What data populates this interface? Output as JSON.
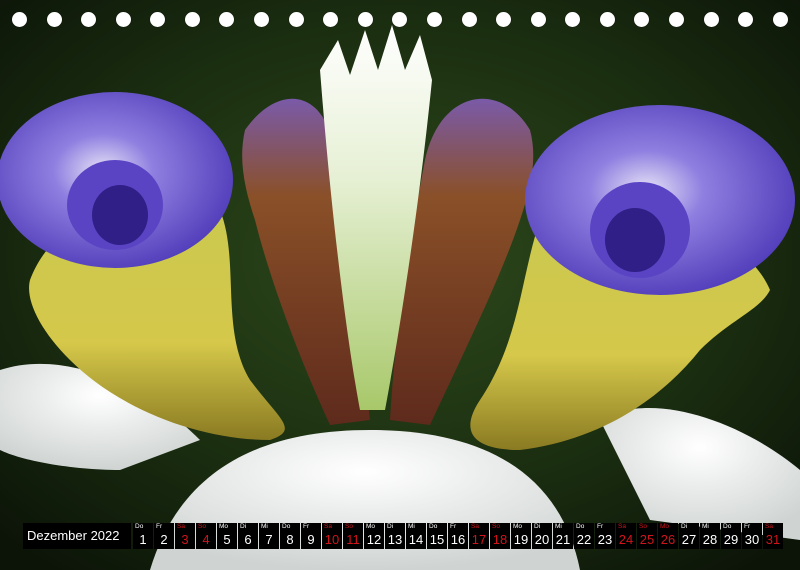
{
  "calendar": {
    "month_label": "Dezember 2022",
    "weekend_color": "#d0141b",
    "days": [
      {
        "wd": "Do",
        "num": "1",
        "weekend": false
      },
      {
        "wd": "Fr",
        "num": "2",
        "weekend": false
      },
      {
        "wd": "Sa",
        "num": "3",
        "weekend": true
      },
      {
        "wd": "So",
        "num": "4",
        "weekend": true
      },
      {
        "wd": "Mo",
        "num": "5",
        "weekend": false
      },
      {
        "wd": "Di",
        "num": "6",
        "weekend": false
      },
      {
        "wd": "Mi",
        "num": "7",
        "weekend": false
      },
      {
        "wd": "Do",
        "num": "8",
        "weekend": false
      },
      {
        "wd": "Fr",
        "num": "9",
        "weekend": false
      },
      {
        "wd": "Sa",
        "num": "10",
        "weekend": true
      },
      {
        "wd": "So",
        "num": "11",
        "weekend": true
      },
      {
        "wd": "Mo",
        "num": "12",
        "weekend": false
      },
      {
        "wd": "Di",
        "num": "13",
        "weekend": false
      },
      {
        "wd": "Mi",
        "num": "14",
        "weekend": false
      },
      {
        "wd": "Do",
        "num": "15",
        "weekend": false
      },
      {
        "wd": "Fr",
        "num": "16",
        "weekend": false
      },
      {
        "wd": "Sa",
        "num": "17",
        "weekend": true
      },
      {
        "wd": "So",
        "num": "18",
        "weekend": true
      },
      {
        "wd": "Mo",
        "num": "19",
        "weekend": false
      },
      {
        "wd": "Di",
        "num": "20",
        "weekend": false
      },
      {
        "wd": "Mi",
        "num": "21",
        "weekend": false
      },
      {
        "wd": "Do",
        "num": "22",
        "weekend": false
      },
      {
        "wd": "Fr",
        "num": "23",
        "weekend": false
      },
      {
        "wd": "Sa",
        "num": "24",
        "weekend": true
      },
      {
        "wd": "So",
        "num": "25",
        "weekend": true
      },
      {
        "wd": "Mo",
        "num": "26",
        "weekend": true
      },
      {
        "wd": "Di",
        "num": "27",
        "weekend": false
      },
      {
        "wd": "Mi",
        "num": "28",
        "weekend": false
      },
      {
        "wd": "Do",
        "num": "29",
        "weekend": false
      },
      {
        "wd": "Fr",
        "num": "30",
        "weekend": false
      },
      {
        "wd": "Sa",
        "num": "31",
        "weekend": true
      }
    ]
  }
}
